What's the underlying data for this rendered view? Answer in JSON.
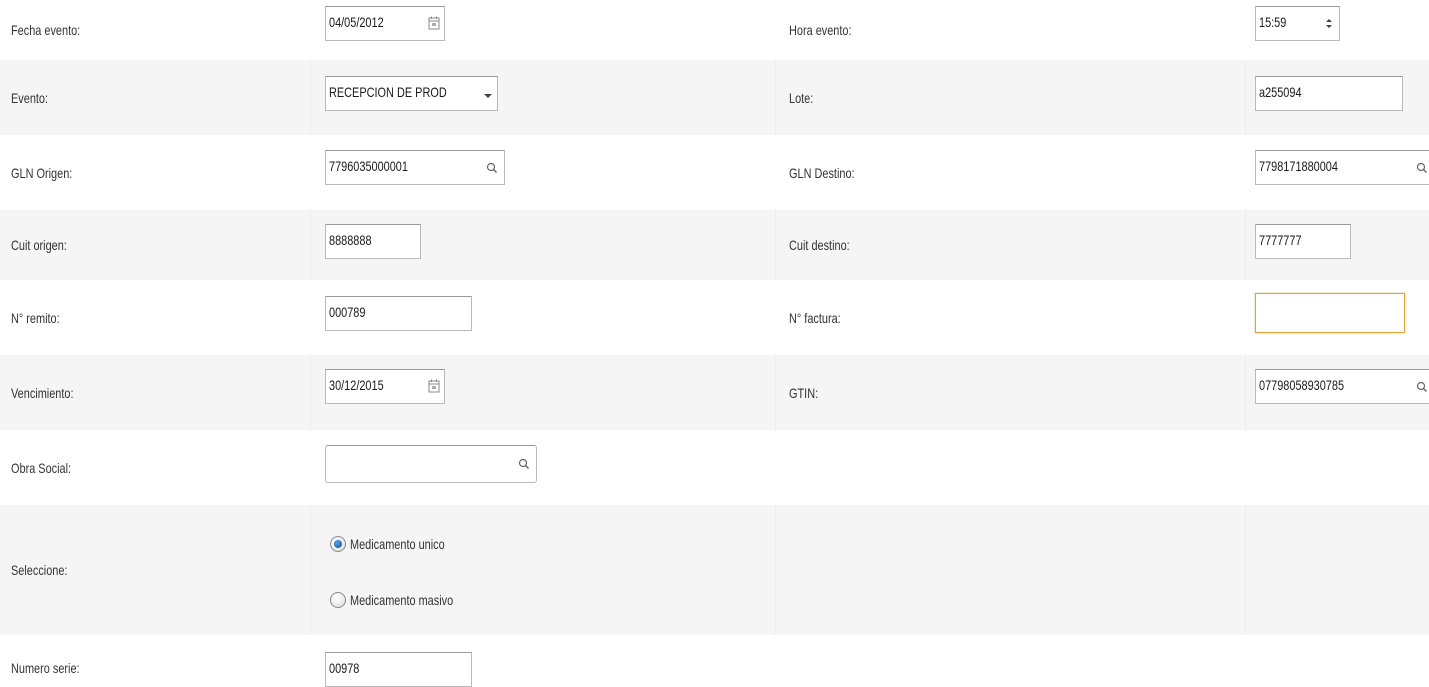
{
  "form": {
    "rows": {
      "fecha_evento": {
        "label": "Fecha evento:",
        "value": "04/05/2012"
      },
      "hora_evento": {
        "label": "Hora evento:",
        "value": "15:59"
      },
      "evento": {
        "label": "Evento:",
        "value": "RECEPCION DE PROD"
      },
      "lote": {
        "label": "Lote:",
        "value": "a255094"
      },
      "gln_origen": {
        "label": "GLN Origen:",
        "value": "7796035000001"
      },
      "gln_destino": {
        "label": "GLN Destino:",
        "value": "7798171880004"
      },
      "cuit_origen": {
        "label": "Cuit origen:",
        "value": "8888888"
      },
      "cuit_destino": {
        "label": "Cuit destino:",
        "value": "7777777"
      },
      "n_remito": {
        "label": "N° remito:",
        "value": "000789"
      },
      "n_factura": {
        "label": "N° factura:",
        "value": ""
      },
      "vencimiento": {
        "label": "Vencimiento:",
        "value": "30/12/2015"
      },
      "gtin": {
        "label": "GTIN:",
        "value": "07798058930785"
      },
      "obra_social": {
        "label": "Obra Social:",
        "value": ""
      },
      "seleccione": {
        "label": "Seleccione:",
        "options": [
          "Medicamento unico",
          "Medicamento masivo"
        ],
        "selected": "Medicamento unico"
      },
      "numero_serie": {
        "label": "Numero serie:",
        "value": "00978"
      }
    }
  },
  "icons": {
    "calendar": "calendar-icon",
    "search": "search-icon",
    "spinner": "spinner-arrows-icon",
    "dropdown": "dropdown-arrow-icon"
  },
  "colors": {
    "alt_row": "#f5f5f5",
    "focus_border": "#e0a43a",
    "radio_selected": "#1a5fa8"
  }
}
